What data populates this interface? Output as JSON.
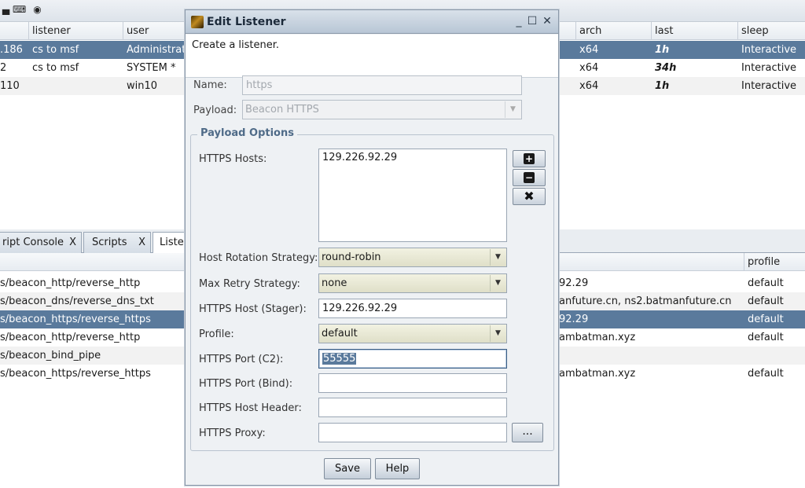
{
  "toolbar": {
    "icons": [
      "folder-icon",
      "keyboard-icon",
      "camera-icon"
    ]
  },
  "sessions": {
    "columns": [
      "listener",
      "user",
      "arch",
      "last",
      "sleep"
    ],
    "rows": [
      {
        "host": ".186",
        "listener": "cs to msf",
        "user": "Administrato",
        "arch": "x64",
        "last": "1h",
        "sleep": "Interactive",
        "selected": true
      },
      {
        "host": "2",
        "listener": "cs to msf",
        "user": "SYSTEM *",
        "arch": "x64",
        "last": "34h",
        "sleep": "Interactive",
        "selected": false
      },
      {
        "host": "110",
        "listener": "",
        "user": "win10",
        "arch": "x64",
        "last": "1h",
        "sleep": "Interactive",
        "selected": false
      }
    ]
  },
  "tabs": [
    {
      "label": "ript Console",
      "close": "X"
    },
    {
      "label": "Scripts",
      "close": "X"
    },
    {
      "label": "Listen",
      "close": ""
    }
  ],
  "listeners": {
    "columns": [
      "profile"
    ],
    "rows": [
      {
        "payload": "s/beacon_http/reverse_http",
        "hosts": "92.29",
        "profile": "default"
      },
      {
        "payload": "s/beacon_dns/reverse_dns_txt",
        "hosts": "anfuture.cn, ns2.batmanfuture.cn",
        "profile": "default"
      },
      {
        "payload": "s/beacon_https/reverse_https",
        "hosts": "92.29",
        "profile": "default"
      },
      {
        "payload": "s/beacon_http/reverse_http",
        "hosts": "ambatman.xyz",
        "profile": "default"
      },
      {
        "payload": "s/beacon_bind_pipe",
        "hosts": "",
        "profile": ""
      },
      {
        "payload": "s/beacon_https/reverse_https",
        "hosts": "ambatman.xyz",
        "profile": "default"
      }
    ]
  },
  "dialog": {
    "title": "Edit Listener",
    "window_controls": [
      "_",
      "☐",
      "✕"
    ],
    "description": "Create a listener.",
    "name_label": "Name:",
    "name_value": "https",
    "payload_label": "Payload:",
    "payload_value": "Beacon HTTPS",
    "group_title": "Payload Options",
    "hosts_label": "HTTPS Hosts:",
    "hosts": [
      "129.226.92.29"
    ],
    "rotation_label": "Host Rotation Strategy:",
    "rotation_value": "round-robin",
    "retry_label": "Max Retry Strategy:",
    "retry_value": "none",
    "stager_label": "HTTPS Host (Stager):",
    "stager_value": "129.226.92.29",
    "profile_label": "Profile:",
    "profile_value": "default",
    "port_c2_label": "HTTPS Port (C2):",
    "port_c2_value": "55555",
    "port_bind_label": "HTTPS Port (Bind):",
    "port_bind_value": "",
    "host_header_label": "HTTPS Host Header:",
    "host_header_value": "",
    "proxy_label": "HTTPS Proxy:",
    "proxy_value": "",
    "proxy_button": "...",
    "save_label": "Save",
    "help_label": "Help"
  }
}
